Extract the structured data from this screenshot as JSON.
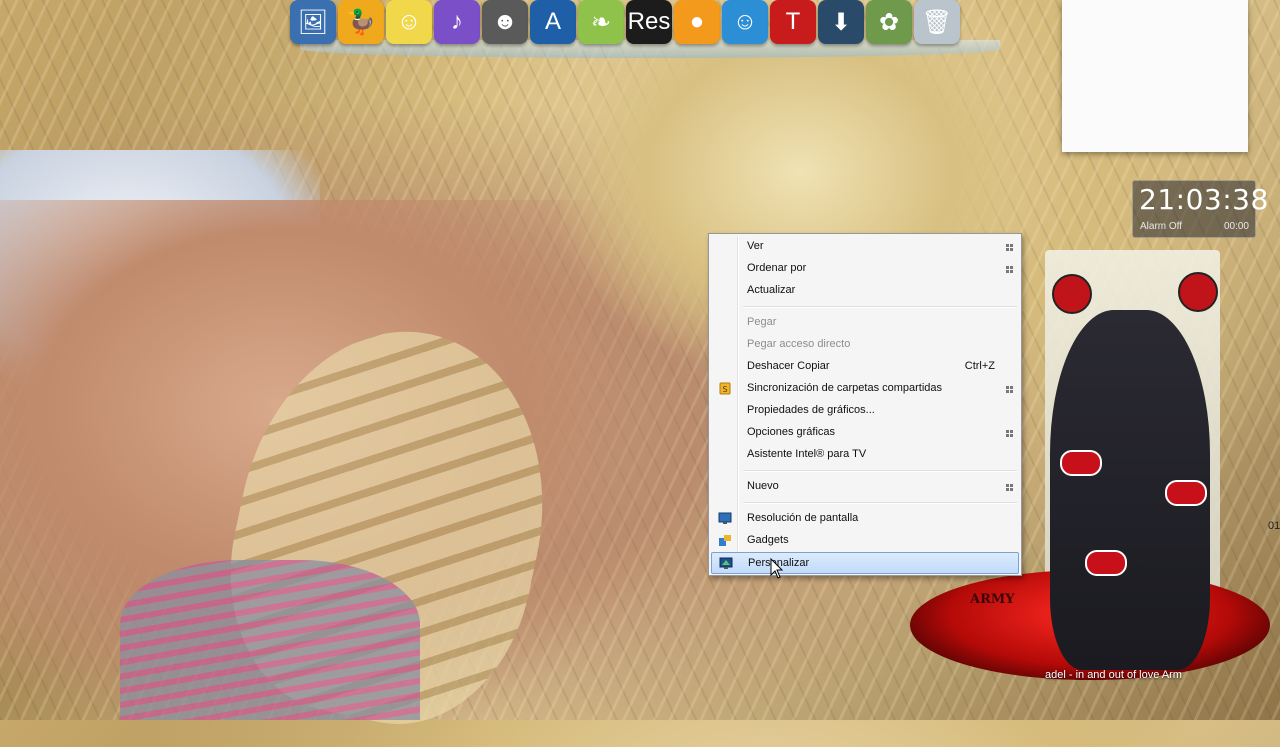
{
  "dock": {
    "icons": [
      {
        "name": "photo-viewer-icon",
        "color": "#3a6fb0",
        "glyph": "🖼"
      },
      {
        "name": "duck-icon",
        "color": "#f0a81c",
        "glyph": "🦆"
      },
      {
        "name": "simpsons-icon",
        "color": "#f1d84a",
        "glyph": "☺"
      },
      {
        "name": "media-player-icon",
        "color": "#7a4fc8",
        "glyph": "♪"
      },
      {
        "name": "game-portrait-icon",
        "color": "#5a5a5a",
        "glyph": "☻"
      },
      {
        "name": "browser-a-icon",
        "color": "#1f5fa8",
        "glyph": "A"
      },
      {
        "name": "leaf-icon",
        "color": "#8fc24a",
        "glyph": "❧"
      },
      {
        "name": "resident-evil-icon",
        "color": "#1c1c1c",
        "glyph": "Res"
      },
      {
        "name": "ball-icon",
        "color": "#f39a1c",
        "glyph": "●"
      },
      {
        "name": "messenger-icon",
        "color": "#2c8fd6",
        "glyph": "☺"
      },
      {
        "name": "sound-icon",
        "color": "#c81c1c",
        "glyph": "T"
      },
      {
        "name": "download-icon",
        "color": "#2a4a6a",
        "glyph": "⬇"
      },
      {
        "name": "flower-icon",
        "color": "#6f9a4c",
        "glyph": "✿"
      },
      {
        "name": "recycle-bin-icon",
        "color": "#b9c4cc",
        "glyph": "🗑"
      }
    ]
  },
  "clock": {
    "time": "21:03:38",
    "alarm": "Alarm Off",
    "alarm_time": "00:00"
  },
  "anime": {
    "logo": "ARMY",
    "side_number": "01"
  },
  "now_playing": "adel - in and out of love    Arm",
  "menu": {
    "items": [
      {
        "label": "Ver",
        "submenu": true
      },
      {
        "label": "Ordenar por",
        "submenu": true
      },
      {
        "label": "Actualizar"
      },
      {
        "label": "Pegar",
        "disabled": true
      },
      {
        "label": "Pegar acceso directo",
        "disabled": true
      },
      {
        "label": "Deshacer Copiar",
        "shortcut": "Ctrl+Z"
      },
      {
        "label": "Sincronización de carpetas compartidas",
        "submenu": true
      },
      {
        "label": "Propiedades de gráficos..."
      },
      {
        "label": "Opciones gráficas",
        "submenu": true
      },
      {
        "label": "Asistente Intel® para TV"
      },
      {
        "label": "Nuevo",
        "submenu": true
      },
      {
        "label": "Resolución de pantalla"
      },
      {
        "label": "Gadgets"
      },
      {
        "label": "Personalizar",
        "selected": true
      }
    ]
  }
}
